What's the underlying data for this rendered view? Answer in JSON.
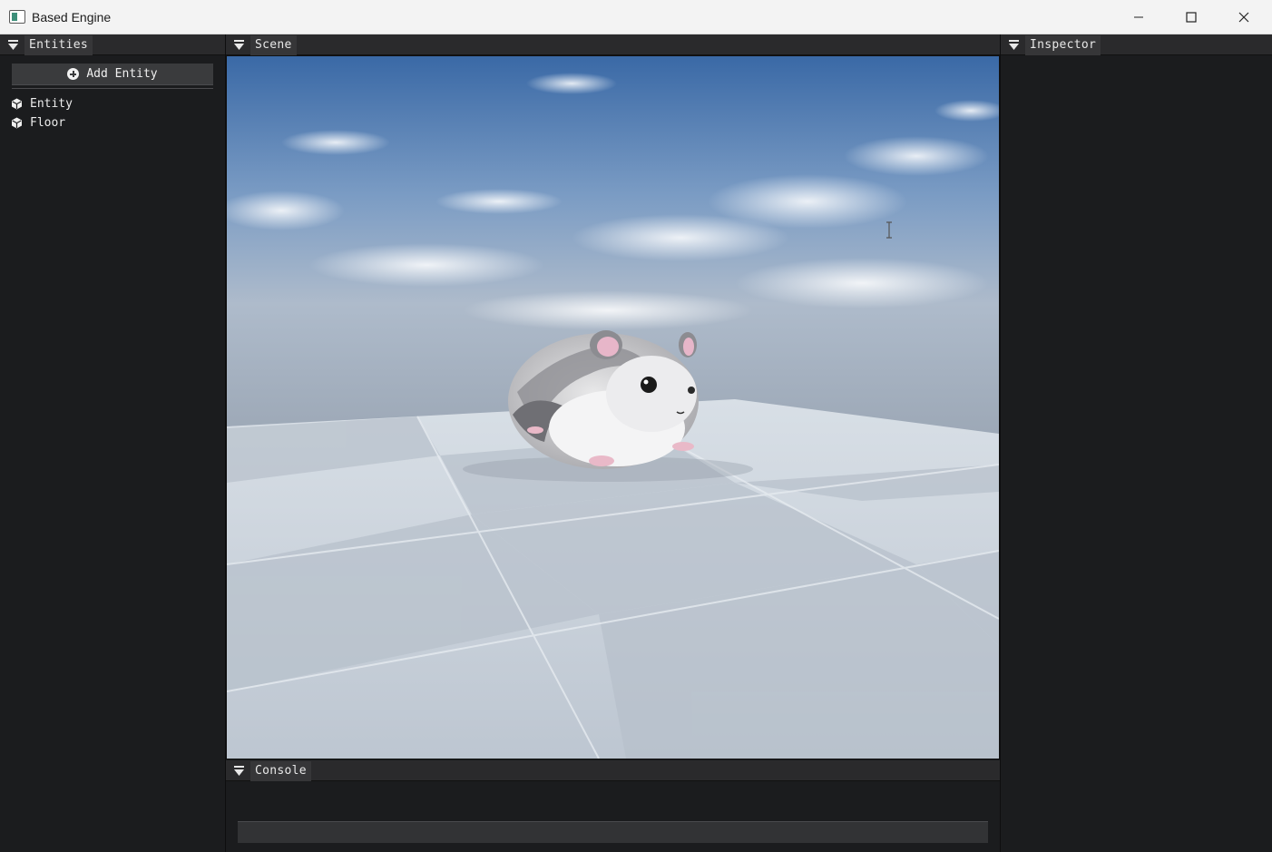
{
  "window": {
    "title": "Based Engine"
  },
  "entities_panel": {
    "tab": "Entities",
    "add_button": "Add Entity",
    "items": [
      {
        "label": "Entity",
        "icon": "cube-icon"
      },
      {
        "label": "Floor",
        "icon": "cube-icon"
      }
    ]
  },
  "scene_panel": {
    "tab": "Scene"
  },
  "inspector_panel": {
    "tab": "Inspector"
  },
  "console_panel": {
    "tab": "Console",
    "input_value": ""
  },
  "colors": {
    "panel_bg": "#1b1c1e",
    "header_bg": "#2a2a2c",
    "tab_bg": "#363638",
    "button_bg": "#3a3b3d",
    "sky_top": "#3e6ea8",
    "floor": "#c9d3dc"
  }
}
